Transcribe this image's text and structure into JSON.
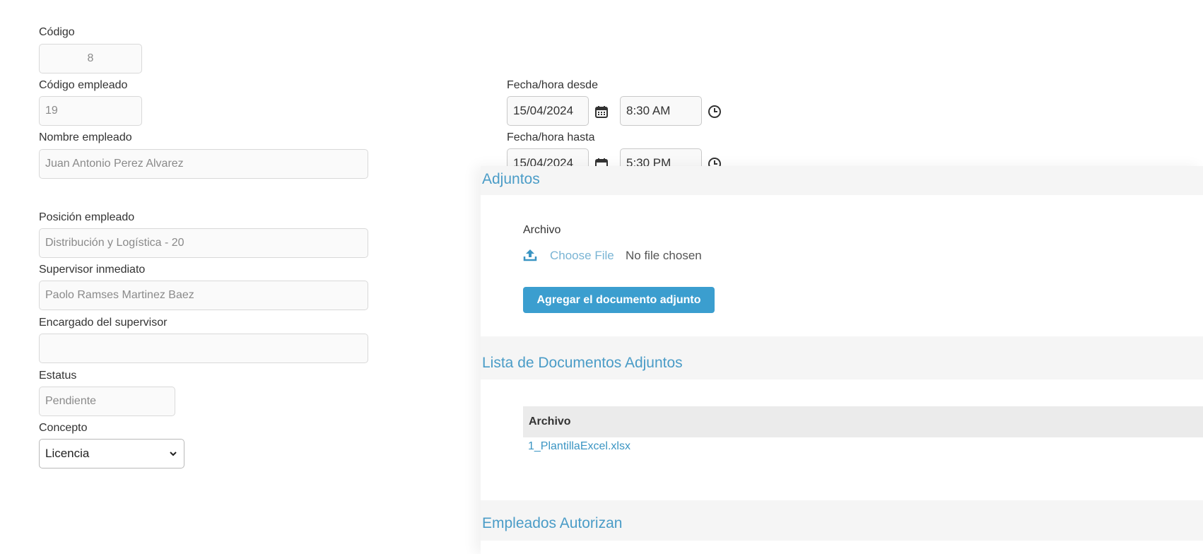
{
  "form": {
    "codigo": {
      "label": "Código",
      "value": "8"
    },
    "codigo_empleado": {
      "label": "Código empleado",
      "value": "19"
    },
    "nombre_empleado": {
      "label": "Nombre empleado",
      "value": "Juan Antonio Perez Alvarez"
    },
    "posicion_empleado": {
      "label": "Posición empleado",
      "value": "Distribución y Logística - 20"
    },
    "supervisor_inmediato": {
      "label": "Supervisor inmediato",
      "value": "Paolo Ramses Martinez Baez"
    },
    "encargado_supervisor": {
      "label": "Encargado del supervisor",
      "value": ""
    },
    "estatus": {
      "label": "Estatus",
      "value": "Pendiente"
    },
    "concepto": {
      "label": "Concepto",
      "selected": "Licencia"
    },
    "fecha_desde": {
      "label": "Fecha/hora desde",
      "date": "15/04/2024",
      "time": "8:30 AM"
    },
    "fecha_hasta": {
      "label": "Fecha/hora hasta",
      "date": "15/04/2024",
      "time": "5:30 PM"
    }
  },
  "adjuntos": {
    "title": "Adjuntos",
    "archivo_label": "Archivo",
    "choose_file": "Choose File",
    "no_file": "No file chosen",
    "add_button": "Agregar el documento adjunto"
  },
  "lista_documentos": {
    "title": "Lista de Documentos Adjuntos",
    "columns": [
      "Archivo"
    ],
    "rows": [
      {
        "archivo": "1_PlantillaExcel.xlsx"
      }
    ]
  },
  "empleados_autorizan": {
    "title": "Empleados Autorizan"
  },
  "colors": {
    "accent": "#3b9ecf",
    "link": "#3b95c3",
    "section_title": "#4a9cc7"
  },
  "icons": {
    "calendar": "calendar-icon",
    "clock": "clock-icon",
    "upload": "upload-icon",
    "chevron": "chevron-down-icon"
  }
}
